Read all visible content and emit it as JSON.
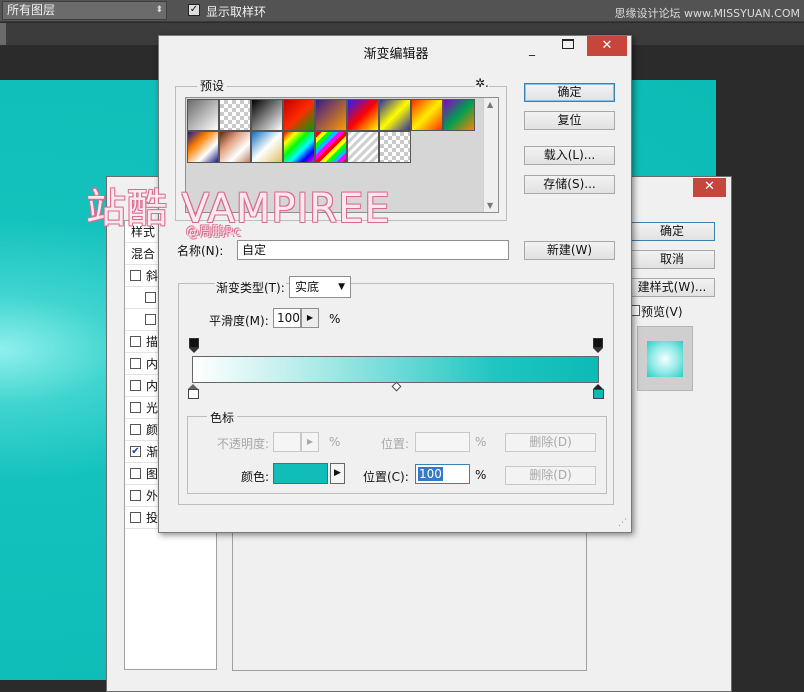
{
  "topbar": {
    "layer_select": "所有图层",
    "sample_label": "显示取样环",
    "site_watermark": "思缘设计论坛 www.MISSYUAN.COM"
  },
  "watermark": {
    "main": "站酷 VAMPIREE",
    "sub": "@周鹏Rc"
  },
  "layer_style": {
    "close": "✕",
    "list_header": "样式",
    "list_header2": "混合",
    "items": [
      {
        "label": "斜",
        "checked": false,
        "indent": false
      },
      {
        "label": "",
        "checked": false,
        "indent": true
      },
      {
        "label": "",
        "checked": false,
        "indent": true
      },
      {
        "label": "描",
        "checked": false,
        "indent": false
      },
      {
        "label": "内",
        "checked": false,
        "indent": false
      },
      {
        "label": "内",
        "checked": false,
        "indent": false
      },
      {
        "label": "光",
        "checked": false,
        "indent": false
      },
      {
        "label": "颜",
        "checked": false,
        "indent": false
      },
      {
        "label": "渐",
        "checked": true,
        "indent": false
      },
      {
        "label": "图",
        "checked": false,
        "indent": false
      },
      {
        "label": "外",
        "checked": false,
        "indent": false
      },
      {
        "label": "投",
        "checked": false,
        "indent": false
      }
    ],
    "ok": "确定",
    "cancel": "取消",
    "new_style": "建样式(W)...",
    "preview": "预览(V)"
  },
  "gradient_editor": {
    "title": "渐变编辑器",
    "minimize": "_",
    "close": "✕",
    "presets_label": "预设",
    "presets_gear": "✲.",
    "presets": [
      "linear-gradient(135deg,#6a6a6a,#fff)",
      "repeating-conic-gradient(#c9c9c9 0 25%,#fff 0 50%) 0 0/8px 8px",
      "linear-gradient(135deg,#000,#fff)",
      "linear-gradient(135deg,#c00000,#ff2a00,#00a000)",
      "linear-gradient(135deg,#3a1a8a,#ff9a00)",
      "linear-gradient(135deg,#2020ff,#ff0000,#ffff00)",
      "linear-gradient(135deg,#3030a0,#ffff00,#3030a0)",
      "linear-gradient(135deg,#ff3000,#ffee00,#ff3000)",
      "linear-gradient(135deg,#8a00c0,#00a050,#ff8000)",
      "linear-gradient(135deg,#1a1a80,#ff8000,#ffffff,#1a1a80)",
      "linear-gradient(135deg,#5a2a10,#e0a080,#fff,#c08060)",
      "linear-gradient(135deg,#1070c0,#ffffff,#e0c060)",
      "linear-gradient(135deg,#ff0000,#ffff00,#00ff00,#00ffff,#0000ff,#ff00ff)",
      "repeating-linear-gradient(135deg,#ff0000 0 4px,#ffff00 4px 8px,#00ff00 8px 12px,#00c0ff 12px 16px,#ff00ff 16px 20px)",
      "repeating-linear-gradient(135deg,#d0d0d0 0 3px,#ffffff 3px 6px)",
      "repeating-conic-gradient(#c9c9c9 0 25%,#fff 0 50%) 0 0/8px 8px"
    ],
    "buttons": {
      "ok": "确定",
      "reset": "复位",
      "load": "载入(L)...",
      "save": "存储(S)...",
      "new": "新建(W)"
    },
    "name_label": "名称(N):",
    "name_value": "自定",
    "type_label": "渐变类型(T):",
    "type_value": "实底",
    "smooth_label": "平滑度(M):",
    "smooth_value": "100",
    "smooth_unit": "%",
    "stops": {
      "label": "色标",
      "opacity_label": "不透明度:",
      "opacity_unit": "%",
      "opacity_pos_label": "位置:",
      "opacity_pos_unit": "%",
      "delete_top": "删除(D)",
      "color_label": "颜色:",
      "color_value": "#10bdb8",
      "pos_label": "位置(C):",
      "pos_value": "100",
      "pos_unit": "%",
      "delete_bottom": "删除(D)"
    },
    "gradient": {
      "start_color": "#ffffff",
      "end_color": "#0cbab5"
    }
  }
}
